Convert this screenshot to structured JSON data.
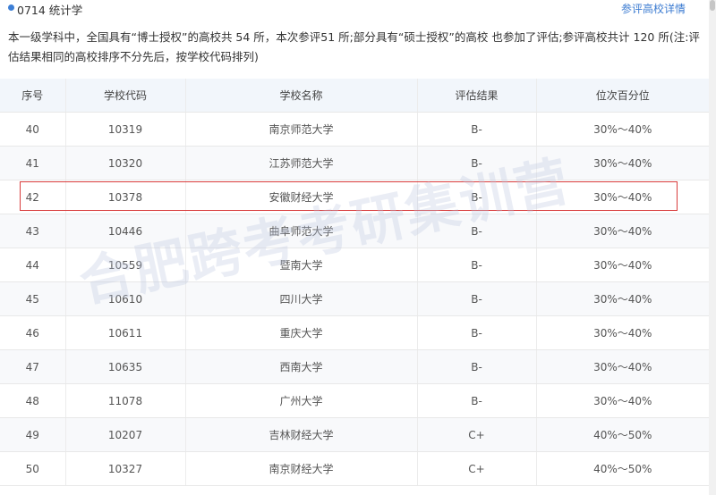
{
  "header": {
    "subject_title": "0714 统计学",
    "detail_link": "参评高校详情"
  },
  "description": "本一级学科中，全国具有“博士授权”的高校共 54 所，本次参评51 所;部分具有“硕士授权”的高校 也参加了评估;参评高校共计 120 所(注:评估结果相同的高校排序不分先后，按学校代码排列)",
  "table": {
    "columns": [
      "序号",
      "学校代码",
      "学校名称",
      "评估结果",
      "位次百分位"
    ],
    "rows": [
      [
        "40",
        "10319",
        "南京师范大学",
        "B-",
        "30%～40%"
      ],
      [
        "41",
        "10320",
        "江苏师范大学",
        "B-",
        "30%～40%"
      ],
      [
        "42",
        "10378",
        "安徽财经大学",
        "B-",
        "30%～40%"
      ],
      [
        "43",
        "10446",
        "曲阜师范大学",
        "B-",
        "30%～40%"
      ],
      [
        "44",
        "10559",
        "暨南大学",
        "B-",
        "30%～40%"
      ],
      [
        "45",
        "10610",
        "四川大学",
        "B-",
        "30%～40%"
      ],
      [
        "46",
        "10611",
        "重庆大学",
        "B-",
        "30%～40%"
      ],
      [
        "47",
        "10635",
        "西南大学",
        "B-",
        "30%～40%"
      ],
      [
        "48",
        "11078",
        "广州大学",
        "B-",
        "30%～40%"
      ],
      [
        "49",
        "10207",
        "吉林财经大学",
        "C+",
        "40%～50%"
      ],
      [
        "50",
        "10327",
        "南京财经大学",
        "C+",
        "40%～50%"
      ]
    ]
  },
  "watermark": "合肥跨考考研集训营",
  "colors": {
    "accent": "#3d7fd6",
    "header_bg": "#f2f6fb",
    "highlight": "#d93c3c"
  }
}
